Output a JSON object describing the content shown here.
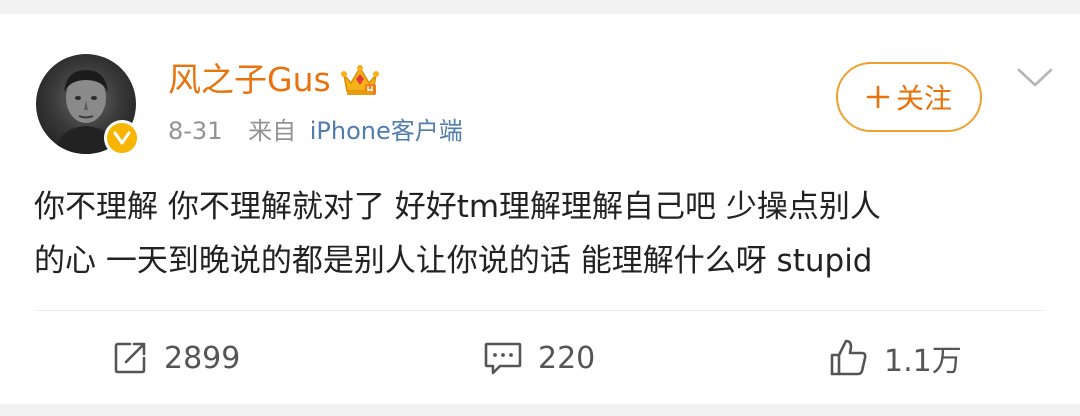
{
  "user": {
    "name": "风之子Gus",
    "verified": true,
    "vip_badge": "crown-icon"
  },
  "meta": {
    "date": "8-31",
    "from_label": "来自",
    "source": "iPhone客户端"
  },
  "follow_button": {
    "label": "关注"
  },
  "post": {
    "line1": "你不理解 你不理解就对了 好好tm理解理解自己吧 少操点别人",
    "line2": "的心 一天到晚说的都是别人让你说的话 能理解什么呀 stupid"
  },
  "actions": {
    "repost_count": "2899",
    "comment_count": "220",
    "like_count": "1.1万"
  },
  "colors": {
    "username": "#e8730c",
    "source_link": "#507daf",
    "follow_border": "#f0a030",
    "verified_badge": "#f7b500"
  }
}
